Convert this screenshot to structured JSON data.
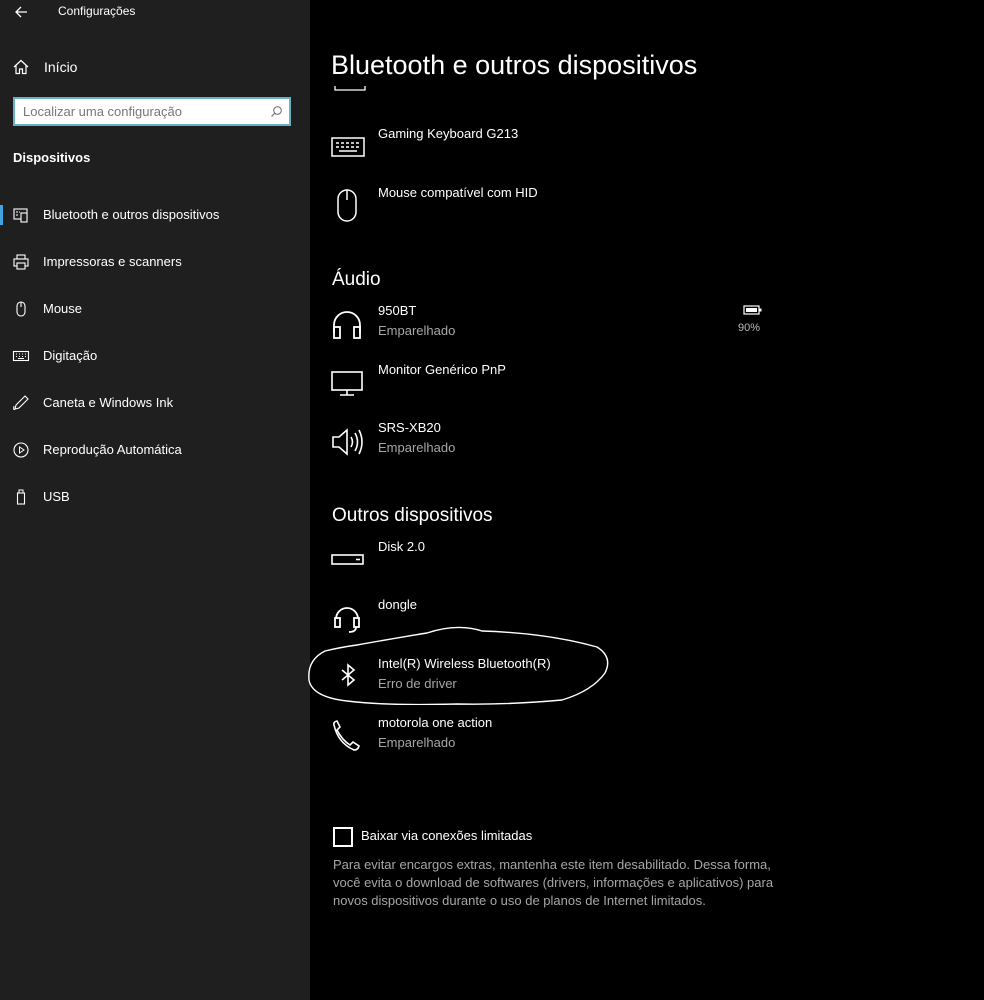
{
  "app": {
    "title": "Configurações"
  },
  "sidebar": {
    "home_label": "Início",
    "search_placeholder": "Localizar uma configuração",
    "section_title": "Dispositivos",
    "items": [
      {
        "label": "Bluetooth e outros dispositivos",
        "icon": "bluetooth-devices-icon",
        "selected": true
      },
      {
        "label": "Impressoras e scanners",
        "icon": "printer-icon"
      },
      {
        "label": "Mouse",
        "icon": "mouse-icon"
      },
      {
        "label": "Digitação",
        "icon": "keyboard-icon"
      },
      {
        "label": "Caneta e Windows Ink",
        "icon": "pen-icon"
      },
      {
        "label": "Reprodução Automática",
        "icon": "autoplay-icon"
      },
      {
        "label": "USB",
        "icon": "usb-icon"
      }
    ]
  },
  "main": {
    "title": "Bluetooth e outros dispositivos",
    "input_devices": [
      {
        "name": "Gaming Keyboard G213",
        "icon": "keyboard-icon"
      },
      {
        "name": "Mouse compatível com HID",
        "icon": "mouse-icon"
      }
    ],
    "audio": {
      "title": "Áudio",
      "devices": [
        {
          "name": "950BT",
          "status": "Emparelhado",
          "icon": "headphones-icon",
          "battery": "90%"
        },
        {
          "name": "Monitor Genérico PnP",
          "icon": "monitor-icon"
        },
        {
          "name": "SRS-XB20",
          "status": "Emparelhado",
          "icon": "speaker-icon"
        }
      ]
    },
    "other": {
      "title": "Outros dispositivos",
      "devices": [
        {
          "name": "Disk 2.0",
          "icon": "drive-icon"
        },
        {
          "name": "dongle",
          "icon": "headset-icon"
        },
        {
          "name": "Intel(R) Wireless Bluetooth(R)",
          "status": "Erro de driver",
          "icon": "bluetooth-icon"
        },
        {
          "name": "motorola one action",
          "status": "Emparelhado",
          "icon": "phone-icon"
        }
      ]
    },
    "metered": {
      "label": "Baixar via conexões limitadas",
      "checked": false,
      "description": "Para evitar encargos extras, mantenha este item desabilitado. Dessa forma, você evita o download de softwares (drivers, informações e aplicativos) para novos dispositivos durante o uso de planos de Internet limitados."
    }
  }
}
